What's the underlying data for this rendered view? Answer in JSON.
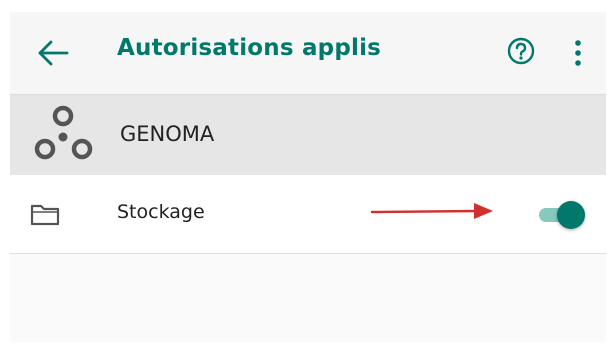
{
  "appbar": {
    "title": "Autorisations applis",
    "back_icon": "arrow-left-icon",
    "help_icon": "help-circle-icon",
    "more_icon": "more-vert-icon"
  },
  "app": {
    "name": "GENOMA",
    "logo_icon": "genoma-logo-icon"
  },
  "permissions": [
    {
      "label": "Stockage",
      "icon": "folder-icon",
      "enabled": true
    }
  ],
  "annotation": {
    "icon": "red-arrow-icon",
    "color": "#d32f2f"
  },
  "colors": {
    "accent": "#00796b",
    "toggle_track": "#86c9be",
    "appbar_bg": "#f6f6f6",
    "app_header_bg": "#e6e6e6"
  }
}
